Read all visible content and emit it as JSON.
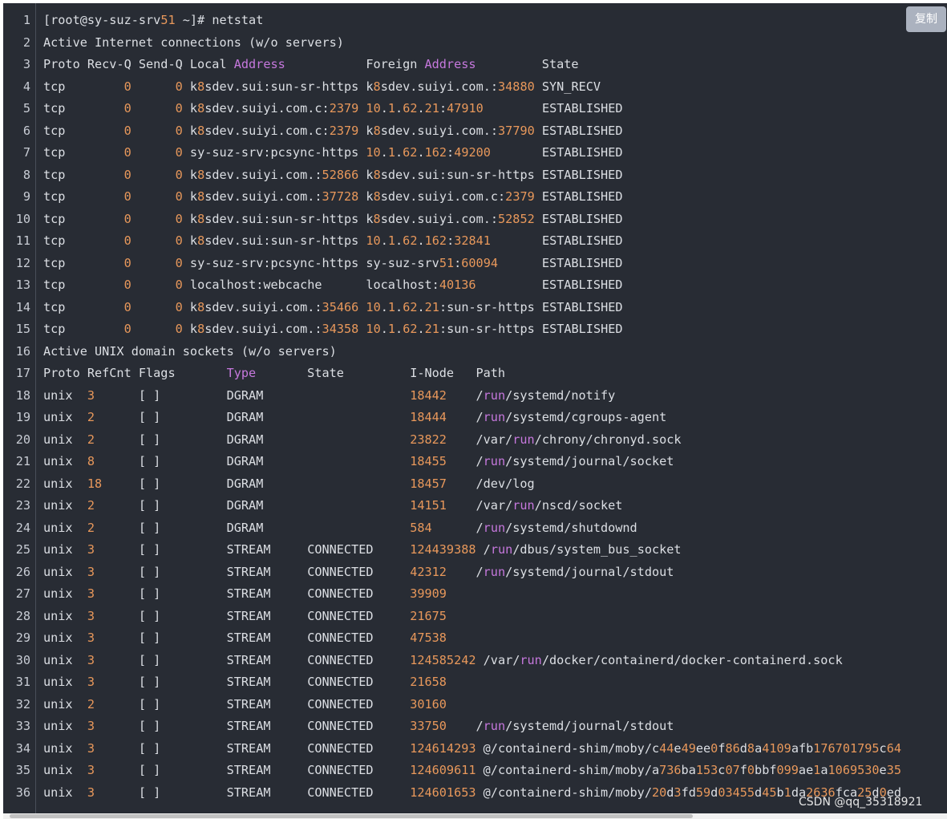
{
  "code_block": {
    "language": "shell",
    "lines": [
      "[root@sy-suz-srv51 ~]# netstat",
      "Active Internet connections (w/o servers)",
      "Proto Recv-Q Send-Q Local Address           Foreign Address         State",
      "tcp        0      0 k8sdev.sui:sun-sr-https k8sdev.suiyi.com.:34880 SYN_RECV",
      "tcp        0      0 k8sdev.suiyi.com.c:2379 10.1.62.21:47910        ESTABLISHED",
      "tcp        0      0 k8sdev.suiyi.com.c:2379 k8sdev.suiyi.com.:37790 ESTABLISHED",
      "tcp        0      0 sy-suz-srv:pcsync-https 10.1.62.162:49200       ESTABLISHED",
      "tcp        0      0 k8sdev.suiyi.com.:52866 k8sdev.sui:sun-sr-https ESTABLISHED",
      "tcp        0      0 k8sdev.suiyi.com.:37728 k8sdev.suiyi.com.c:2379 ESTABLISHED",
      "tcp        0      0 k8sdev.sui:sun-sr-https k8sdev.suiyi.com.:52852 ESTABLISHED",
      "tcp        0      0 k8sdev.sui:sun-sr-https 10.1.62.162:32841       ESTABLISHED",
      "tcp        0      0 sy-suz-srv:pcsync-https sy-suz-srv51:60094      ESTABLISHED",
      "tcp        0      0 localhost:webcache      localhost:40136         ESTABLISHED",
      "tcp        0      0 k8sdev.suiyi.com.:35466 10.1.62.21:sun-sr-https ESTABLISHED",
      "tcp        0      0 k8sdev.suiyi.com.:34358 10.1.62.21:sun-sr-https ESTABLISHED",
      "Active UNIX domain sockets (w/o servers)",
      "Proto RefCnt Flags       Type       State         I-Node   Path",
      "unix  3      [ ]         DGRAM                    18442    /run/systemd/notify",
      "unix  2      [ ]         DGRAM                    18444    /run/systemd/cgroups-agent",
      "unix  2      [ ]         DGRAM                    23822    /var/run/chrony/chronyd.sock",
      "unix  8      [ ]         DGRAM                    18455    /run/systemd/journal/socket",
      "unix  18     [ ]         DGRAM                    18457    /dev/log",
      "unix  2      [ ]         DGRAM                    14151    /var/run/nscd/socket",
      "unix  2      [ ]         DGRAM                    584      /run/systemd/shutdownd",
      "unix  3      [ ]         STREAM     CONNECTED     124439388 /run/dbus/system_bus_socket",
      "unix  3      [ ]         STREAM     CONNECTED     42312    /run/systemd/journal/stdout",
      "unix  3      [ ]         STREAM     CONNECTED     39909    ",
      "unix  3      [ ]         STREAM     CONNECTED     21675    ",
      "unix  3      [ ]         STREAM     CONNECTED     47538    ",
      "unix  3      [ ]         STREAM     CONNECTED     124585242 /var/run/docker/containerd/docker-containerd.sock",
      "unix  3      [ ]         STREAM     CONNECTED     21658    ",
      "unix  2      [ ]         STREAM     CONNECTED     30160    ",
      "unix  3      [ ]         STREAM     CONNECTED     33750    /run/systemd/journal/stdout",
      "unix  3      [ ]         STREAM     CONNECTED     124614293 @/containerd-shim/moby/c44e49ee0f86d8a4109afb176701795c64",
      "unix  3      [ ]         STREAM     CONNECTED     124609611 @/containerd-shim/moby/a736ba153c07f0bbf099ae1a1069530e35",
      "unix  3      [ ]         STREAM     CONNECTED     124601653 @/containerd-shim/moby/20d3fd59d03455d45b1da2636fca25d0ed"
    ]
  },
  "copy_button": {
    "label": "复制"
  },
  "watermark": {
    "text": "CSDN @qq_35318921"
  },
  "colors": {
    "background": "#282c34",
    "text": "#dcdfe4",
    "number": "#e8985b",
    "keyword": "#c678dd"
  }
}
